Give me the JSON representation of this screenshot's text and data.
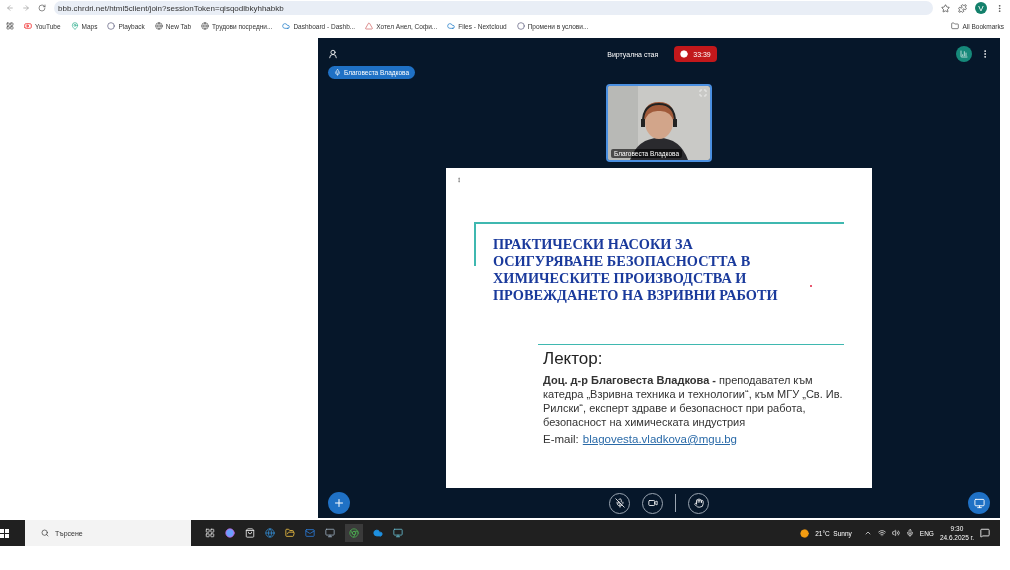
{
  "browser": {
    "url": "bbb.chrdri.net/html5client/join?sessionToken=qisqodlbkyhhabkb",
    "profile_initial": "V",
    "bookmarks": [
      "YouTube",
      "Maps",
      "Playback",
      "New Tab",
      "Трудови посредни...",
      "Dashboard - Dashb...",
      "Хотел Анел, Софи...",
      "Files - Nextcloud",
      "Промени в услови..."
    ],
    "all_bookmarks": "All Bookmarks"
  },
  "meeting": {
    "title": "Виртуална стая",
    "recording_time": "33:39",
    "talking": "Благовеста Владкова",
    "video": {
      "name": "Благовеста Владкова"
    },
    "slide": {
      "title_lines": [
        "ПРАКТИЧЕСКИ НАСОКИ ЗА",
        "ОСИГУРЯВАНЕ БЕЗОПАСНОСТТА В",
        "ХИМИЧЕСКИТЕ ПРОИЗВОДСТВА И",
        "ПРОВЕЖДАНЕТО НА ВЗРИВНИ РАБОТИ"
      ],
      "lecturer_label": "Лектор:",
      "lecturer_text": "**Доц. д-р Благовеста Владкова -** преподавател към катедра „Взривна техника и технологии“, към МГУ „Св. Ив. Рилски“, експерт здраве и безопасност при работа, безопасност на химическата индустрия",
      "email_label": "E-mail:",
      "email": "blagovesta.vladkova@mgu.bg"
    }
  },
  "taskbar": {
    "search_placeholder": "Търсене",
    "weather": "21°C  Sunny",
    "language": "ENG",
    "time": "9:30",
    "date": "24.6.2025 г."
  }
}
